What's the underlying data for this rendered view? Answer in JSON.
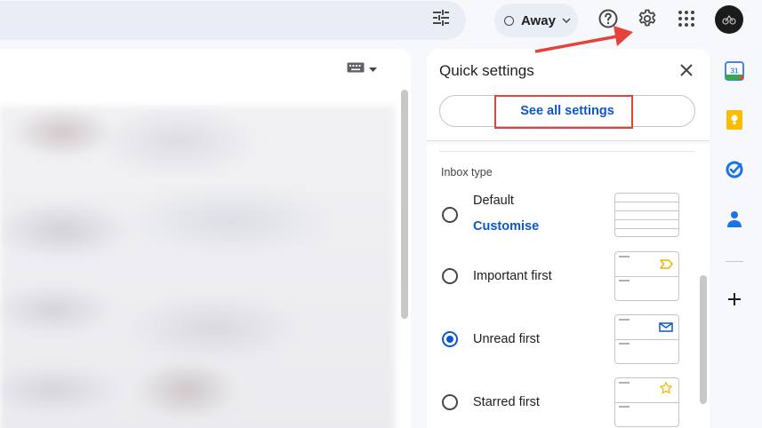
{
  "header": {
    "status_label": "Away"
  },
  "quick_settings": {
    "title": "Quick settings",
    "see_all_label": "See all settings",
    "inbox_type_label": "Inbox type",
    "options": [
      {
        "label": "Default",
        "link": "Customise",
        "selected": false
      },
      {
        "label": "Important first",
        "selected": false
      },
      {
        "label": "Unread first",
        "selected": true
      },
      {
        "label": "Starred first",
        "selected": false
      }
    ]
  },
  "side_panel": {
    "calendar_day": "31"
  },
  "colors": {
    "accent_blue": "#0b57d0",
    "annotation_red": "#e5433a",
    "search_bg": "#e9eef6",
    "page_bg": "#f6f8fc"
  },
  "icons": [
    "filter-icon",
    "status-ring-icon",
    "chevron-down-icon",
    "help-icon",
    "gear-icon",
    "apps-grid-icon",
    "avatar",
    "keyboard-icon",
    "close-icon",
    "important-marker-icon",
    "envelope-icon",
    "star-icon",
    "calendar-icon",
    "keep-icon",
    "tasks-icon",
    "contacts-icon",
    "plus-icon"
  ]
}
